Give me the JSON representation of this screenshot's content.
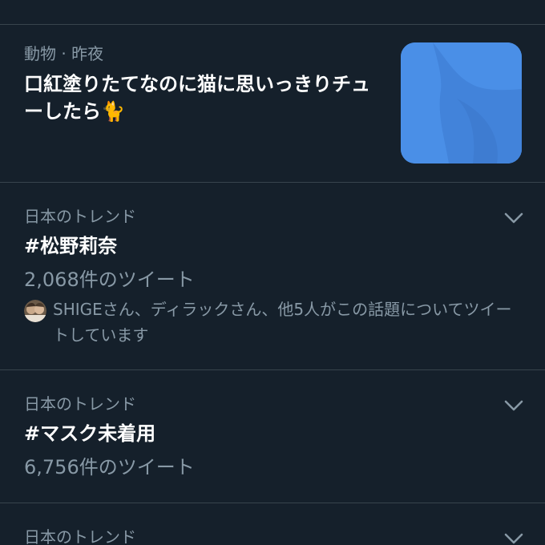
{
  "moment": {
    "meta": "動物 · 昨夜",
    "headline": "口紅塗りたてなのに猫に思いっきりチューしたら🐈",
    "thumbnail_icon": "bird-logo-icon",
    "thumbnail_color": "#4a8fe7"
  },
  "trends": [
    {
      "context": "日本のトレンド",
      "name": "#松野莉奈",
      "count": "2,068件のツイート",
      "social": "SHIGEさん、ディラックさん、他5人がこの話題についてツイートしています"
    },
    {
      "context": "日本のトレンド",
      "name": "#マスク未着用",
      "count": "6,756件のツイート"
    },
    {
      "context": "日本のトレンド"
    }
  ],
  "colors": {
    "background": "#15202b",
    "divider": "#38444d",
    "secondary_text": "#8899a6",
    "primary_text": "#ffffff"
  }
}
